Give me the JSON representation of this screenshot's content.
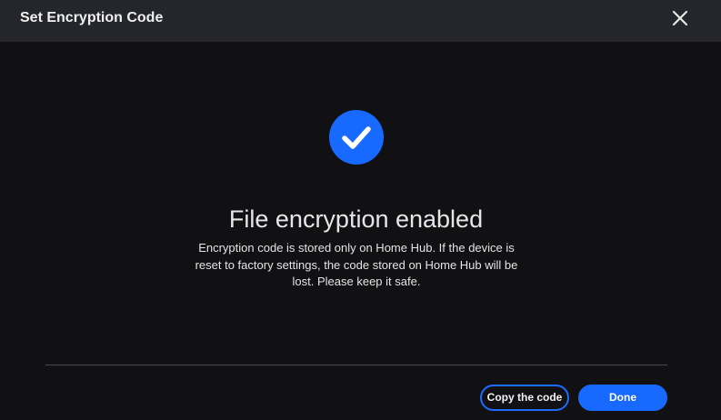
{
  "dialog": {
    "title": "Set Encryption Code",
    "close_icon": "close-icon"
  },
  "status": {
    "icon": "checkmark-circle-icon",
    "icon_color": "#1769ff",
    "title": "File encryption enabled",
    "description": "Encryption code is stored only on Home Hub. If the device is reset to factory settings, the code stored on Home Hub will be lost. Please keep it safe."
  },
  "footer": {
    "copy_label": "Copy the code",
    "done_label": "Done"
  },
  "colors": {
    "accent": "#1769ff",
    "background": "#111113",
    "header": "#24262b"
  }
}
